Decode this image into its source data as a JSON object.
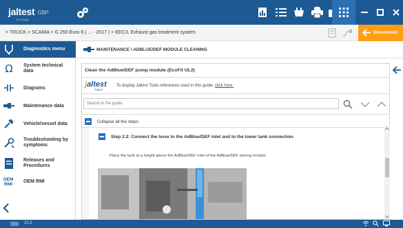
{
  "app": {
    "logo": "jaltest",
    "logo_sub": "BY COJALI",
    "edition": "GBP"
  },
  "breadcrumb": "> TRUCK  >  SCANIA  >  G 250 Euro 6 ( ... - 2017 )  >  EEC3, Exhaust gas treatment system",
  "disconnect_label": "Disconnect",
  "sidebar": {
    "items": [
      {
        "label": "Diagnostics menu",
        "icon": "diagnostics-icon"
      },
      {
        "label": "System technical data",
        "icon": "ohm-icon"
      },
      {
        "label": "Diagrams",
        "icon": "diagram-icon"
      },
      {
        "label": "Maintenance data",
        "icon": "wrench-icon"
      },
      {
        "label": "Vehicle/vessel data",
        "icon": "vehicle-data-icon"
      },
      {
        "label": "Troubleshooting by symptoms",
        "icon": "troubleshooting-icon"
      },
      {
        "label": "Releases and Procedures",
        "icon": "releases-icon"
      },
      {
        "label": "OEM RMI",
        "icon": "oem-rmi-icon"
      }
    ]
  },
  "main": {
    "header": "MAINTENANCE \\ ADBLUE/DEF MODULE CLEANING",
    "guide_title": "Clean the AdBlue/DEF pump module (EcoFit UL2)",
    "tools_logo": "jaltest",
    "tools_logo_sub": "TOOLS",
    "tools_msg": "To display Jaltest Tools references used in this guide, ",
    "tools_link": "click here.",
    "search_placeholder": "Search in the guide",
    "collapse_label": "Collapse all the steps",
    "step_title": "Step 2.2: Connect the hose to the AdBlue/DEF inlet and to the lower tank connection.",
    "step_text": "Place the tank at a height above the AdBlue/DEF inlet of the AdBlue/DEF dosing module."
  },
  "status": {
    "version": "22.2"
  },
  "colors": {
    "primary": "#1d5a93",
    "accent": "#ff9e15",
    "step_box": "#2a73b8"
  }
}
